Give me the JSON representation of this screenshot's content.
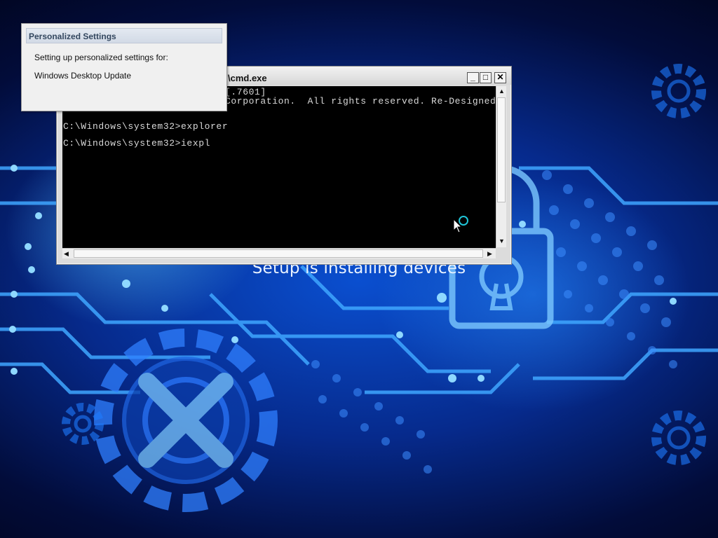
{
  "background": {
    "setup_status": "Setup is installing devices",
    "colors": {
      "deep": "#020c3a",
      "mid": "#0a4fd0",
      "glow": "#5ac8ff"
    }
  },
  "cmd_window": {
    "title": "\\cmd.exe",
    "buttons": {
      "minimize": "_",
      "maximize": "□",
      "close": "✕"
    },
    "console_lines": [
      "[.7601]",
      "Corporation.  All rights reserved. Re-Designed B",
      "C:\\Windows\\system32>explorer",
      "C:\\Windows\\system32>iexpl"
    ],
    "scroll_arrows": {
      "up": "▲",
      "down": "▼",
      "left": "◀",
      "right": "▶"
    }
  },
  "personalized_settings": {
    "title": "Personalized Settings",
    "line1": "Setting up personalized settings for:",
    "line2": "Windows Desktop Update"
  },
  "icons": [
    "gear-icon",
    "padlock-icon",
    "busy-cursor-icon",
    "arrow-cursor-icon"
  ]
}
